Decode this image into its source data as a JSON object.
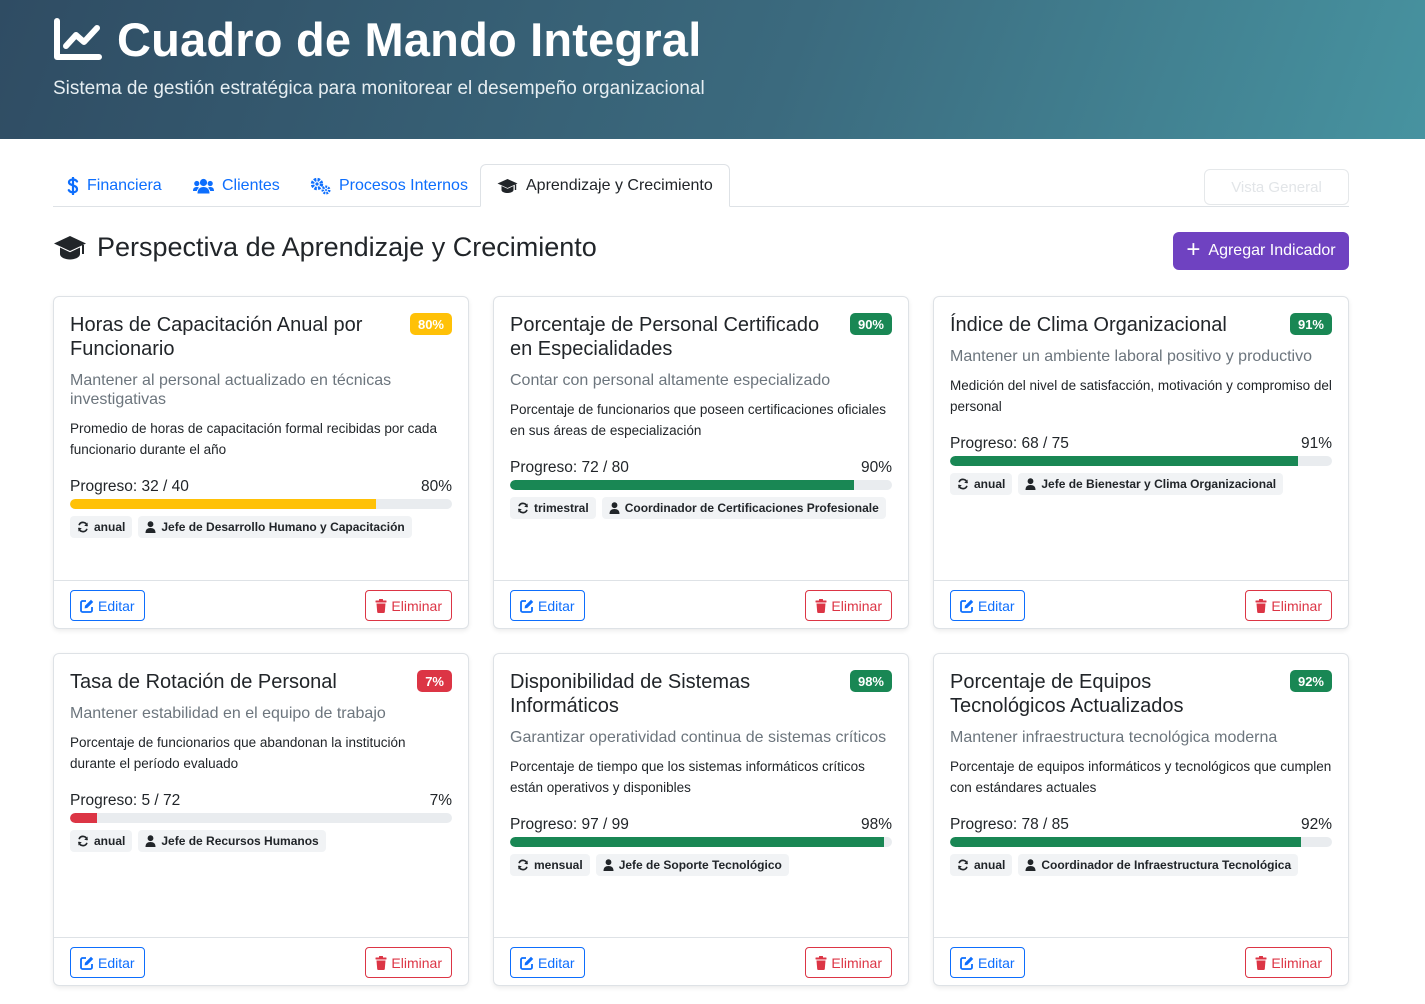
{
  "header": {
    "title": "Cuadro de Mando Integral",
    "subtitle": "Sistema de gestión estratégica para monitorear el desempeño organizacional"
  },
  "tabs": [
    {
      "label": "Financiera",
      "icon": "dollar-icon"
    },
    {
      "label": "Clientes",
      "icon": "users-icon"
    },
    {
      "label": "Procesos Internos",
      "icon": "gears-icon"
    },
    {
      "label": "Aprendizaje y Crecimiento",
      "icon": "graduation-cap-icon",
      "active": true
    }
  ],
  "overview_button": "Vista General",
  "section": {
    "title": "Perspectiva de Aprendizaje y Crecimiento",
    "add_button": "Agregar Indicador"
  },
  "colors": {
    "warning": "#ffc107",
    "success": "#198754",
    "danger": "#dc3545",
    "primary": "#0d6efd",
    "purple": "#6f42c1"
  },
  "labels": {
    "edit": "Editar",
    "delete": "Eliminar"
  },
  "cards": [
    {
      "title": "Horas de Capacitación Anual por Funcionario",
      "badge": "80%",
      "status": "warning",
      "objective": "Mantener al personal actualizado en técnicas investigativas",
      "description": "Promedio de horas de capacitación formal recibidas por cada funcionario durante el año",
      "progress_text": "Progreso: 32 / 40",
      "percent_text": "80%",
      "percent": 80,
      "frequency": "anual",
      "responsible": "Jefe de Desarrollo Humano y Capacitación"
    },
    {
      "title": "Porcentaje de Personal Certificado en Especialidades",
      "badge": "90%",
      "status": "success",
      "objective": "Contar con personal altamente especializado",
      "description": "Porcentaje de funcionarios que poseen certificaciones oficiales en sus áreas de especialización",
      "progress_text": "Progreso: 72 / 80",
      "percent_text": "90%",
      "percent": 90,
      "frequency": "trimestral",
      "responsible": "Coordinador de Certificaciones Profesionale"
    },
    {
      "title": "Índice de Clima Organizacional",
      "badge": "91%",
      "status": "success",
      "objective": "Mantener un ambiente laboral positivo y productivo",
      "description": "Medición del nivel de satisfacción, motivación y compromiso del personal",
      "progress_text": "Progreso: 68 / 75",
      "percent_text": "91%",
      "percent": 91,
      "frequency": "anual",
      "responsible": "Jefe de Bienestar y Clima Organizacional"
    },
    {
      "title": "Tasa de Rotación de Personal",
      "badge": "7%",
      "status": "danger",
      "objective": "Mantener estabilidad en el equipo de trabajo",
      "description": "Porcentaje de funcionarios que abandonan la institución durante el período evaluado",
      "progress_text": "Progreso: 5 / 72",
      "percent_text": "7%",
      "percent": 7,
      "frequency": "anual",
      "responsible": "Jefe de Recursos Humanos"
    },
    {
      "title": "Disponibilidad de Sistemas Informáticos",
      "badge": "98%",
      "status": "success",
      "objective": "Garantizar operatividad continua de sistemas críticos",
      "description": "Porcentaje de tiempo que los sistemas informáticos críticos están operativos y disponibles",
      "progress_text": "Progreso: 97 / 99",
      "percent_text": "98%",
      "percent": 98,
      "frequency": "mensual",
      "responsible": "Jefe de Soporte Tecnológico"
    },
    {
      "title": "Porcentaje de Equipos Tecnológicos Actualizados",
      "badge": "92%",
      "status": "success",
      "objective": "Mantener infraestructura tecnológica moderna",
      "description": "Porcentaje de equipos informáticos y tecnológicos que cumplen con estándares actuales",
      "progress_text": "Progreso: 78 / 85",
      "percent_text": "92%",
      "percent": 92,
      "frequency": "anual",
      "responsible": "Coordinador de Infraestructura Tecnológica"
    }
  ]
}
